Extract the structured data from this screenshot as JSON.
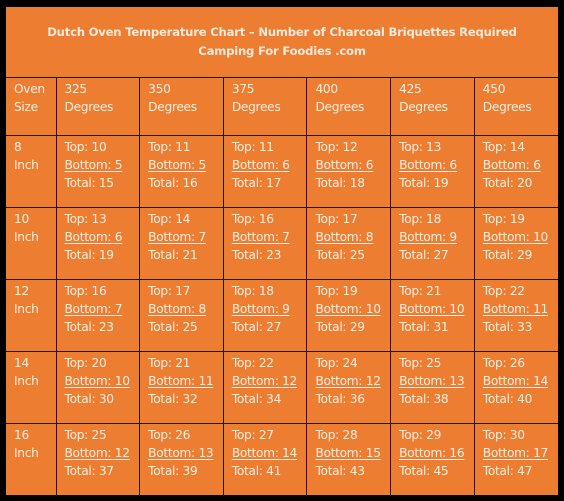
{
  "title": {
    "line1": "Dutch Oven Temperature Chart – Number of Charcoal Briquettes Required",
    "line2": "Camping For Foodies .com"
  },
  "header": {
    "size_label_1": "Oven",
    "size_label_2": "Size",
    "columns": [
      {
        "temp": "325",
        "unit": "Degrees"
      },
      {
        "temp": "350",
        "unit": "Degrees"
      },
      {
        "temp": "375",
        "unit": "Degrees"
      },
      {
        "temp": "400",
        "unit": "Degrees"
      },
      {
        "temp": "425",
        "unit": "Degrees"
      },
      {
        "temp": "450",
        "unit": "Degrees"
      }
    ]
  },
  "rows": [
    {
      "size": "8",
      "unit": "Inch",
      "cells": [
        {
          "top": "Top: 10",
          "bottom": "Bottom: 5",
          "total": "Total: 15"
        },
        {
          "top": "Top: 11",
          "bottom": "Bottom: 5",
          "total": "Total: 16"
        },
        {
          "top": "Top: 11",
          "bottom": "Bottom: 6",
          "total": "Total: 17"
        },
        {
          "top": "Top: 12",
          "bottom": "Bottom: 6",
          "total": "Total: 18"
        },
        {
          "top": "Top: 13",
          "bottom": "Bottom: 6",
          "total": "Total: 19"
        },
        {
          "top": "Top: 14",
          "bottom": "Bottom: 6",
          "total": "Total: 20"
        }
      ]
    },
    {
      "size": "10",
      "unit": "Inch",
      "cells": [
        {
          "top": "Top: 13",
          "bottom": "Bottom: 6",
          "total": "Total: 19"
        },
        {
          "top": "Top: 14",
          "bottom": "Bottom: 7",
          "total": "Total: 21"
        },
        {
          "top": "Top: 16",
          "bottom": "Bottom: 7",
          "total": "Total: 23"
        },
        {
          "top": "Top: 17",
          "bottom": "Bottom: 8",
          "total": "Total: 25"
        },
        {
          "top": "Top: 18",
          "bottom": "Bottom: 9",
          "total": "Total: 27"
        },
        {
          "top": "Top: 19",
          "bottom": "Bottom: 10",
          "total": "Total: 29"
        }
      ]
    },
    {
      "size": "12",
      "unit": "Inch",
      "cells": [
        {
          "top": "Top: 16",
          "bottom": "Bottom: 7",
          "total": "Total: 23"
        },
        {
          "top": "Top: 17",
          "bottom": "Bottom: 8",
          "total": "Total: 25"
        },
        {
          "top": "Top: 18",
          "bottom": "Bottom: 9",
          "total": "Total: 27"
        },
        {
          "top": "Top: 19",
          "bottom": "Bottom: 10",
          "total": "Total: 29"
        },
        {
          "top": "Top: 21",
          "bottom": "Bottom: 10",
          "total": "Total: 31"
        },
        {
          "top": "Top: 22",
          "bottom": "Bottom: 11",
          "total": "Total: 33"
        }
      ]
    },
    {
      "size": "14",
      "unit": "Inch",
      "cells": [
        {
          "top": "Top: 20",
          "bottom": "Bottom: 10",
          "total": "Total: 30"
        },
        {
          "top": "Top: 21",
          "bottom": "Bottom: 11",
          "total": "Total: 32"
        },
        {
          "top": "Top: 22",
          "bottom": "Bottom: 12",
          "total": "Total: 34"
        },
        {
          "top": "Top: 24",
          "bottom": "Bottom: 12",
          "total": "Total: 36"
        },
        {
          "top": "Top: 25",
          "bottom": "Bottom: 13",
          "total": "Total: 38"
        },
        {
          "top": "Top: 26",
          "bottom": "Bottom: 14",
          "total": "Total: 40"
        }
      ]
    },
    {
      "size": "16",
      "unit": "Inch",
      "cells": [
        {
          "top": "Top: 25",
          "bottom": "Bottom: 12",
          "total": "Total: 37"
        },
        {
          "top": "Top: 26",
          "bottom": "Bottom: 13",
          "total": "Total: 39"
        },
        {
          "top": "Top: 27",
          "bottom": "Bottom: 14",
          "total": "Total: 41"
        },
        {
          "top": "Top: 28",
          "bottom": "Bottom: 15",
          "total": "Total: 43"
        },
        {
          "top": "Top: 29",
          "bottom": "Bottom: 16",
          "total": "Total: 45"
        },
        {
          "top": "Top: 30",
          "bottom": "Bottom: 17",
          "total": "Total: 47"
        }
      ]
    }
  ],
  "colors": {
    "background": "#ED7D31",
    "text": "#FCEEE3",
    "border": "#2A1208",
    "outer": "#000000"
  }
}
